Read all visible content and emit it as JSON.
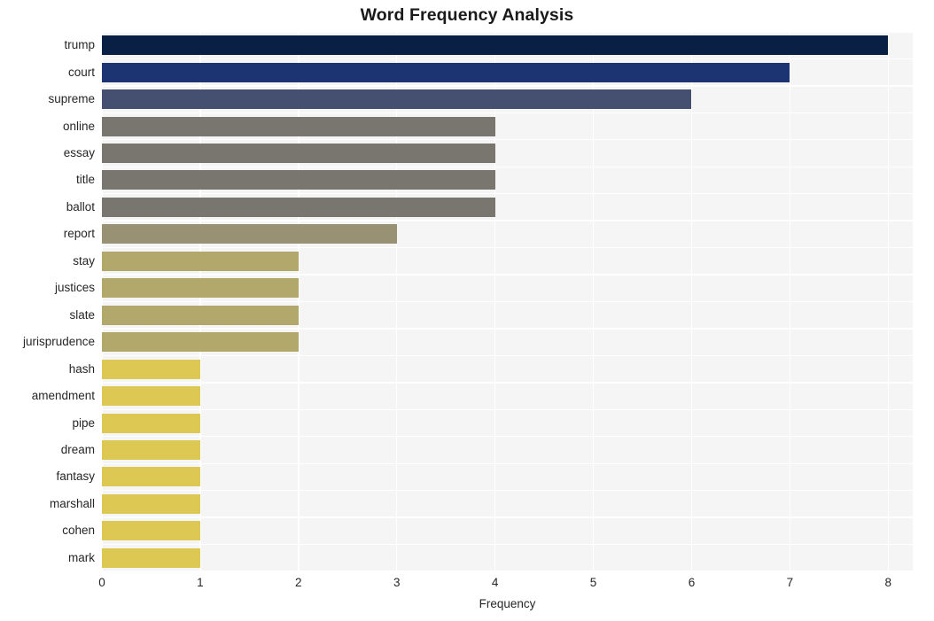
{
  "chart_data": {
    "type": "bar",
    "orientation": "horizontal",
    "title": "Word Frequency Analysis",
    "xlabel": "Frequency",
    "ylabel": "",
    "xlim": [
      0,
      8.25
    ],
    "xticks": [
      0,
      1,
      2,
      3,
      4,
      5,
      6,
      7,
      8
    ],
    "xtick_labels": [
      "0",
      "1",
      "2",
      "3",
      "4",
      "5",
      "6",
      "7",
      "8"
    ],
    "grid": true,
    "legend": "none",
    "background": "#f5f5f5",
    "gridline_color": "#ffffff",
    "categories": [
      "trump",
      "court",
      "supreme",
      "online",
      "essay",
      "title",
      "ballot",
      "report",
      "stay",
      "justices",
      "slate",
      "jurisprudence",
      "hash",
      "amendment",
      "pipe",
      "dream",
      "fantasy",
      "marshall",
      "cohen",
      "mark"
    ],
    "values": [
      8,
      7,
      6,
      4,
      4,
      4,
      4,
      3,
      2,
      2,
      2,
      2,
      1,
      1,
      1,
      1,
      1,
      1,
      1,
      1
    ],
    "bar_colors": [
      "#0a1f44",
      "#1d3473",
      "#454f70",
      "#78766f",
      "#78766f",
      "#78766f",
      "#78766f",
      "#999174",
      "#b3a86b",
      "#b3a86b",
      "#b3a86b",
      "#b3a86b",
      "#dcc853",
      "#dcc853",
      "#dcc853",
      "#dcc853",
      "#dcc853",
      "#dcc853",
      "#dcc853",
      "#dcc853"
    ]
  }
}
